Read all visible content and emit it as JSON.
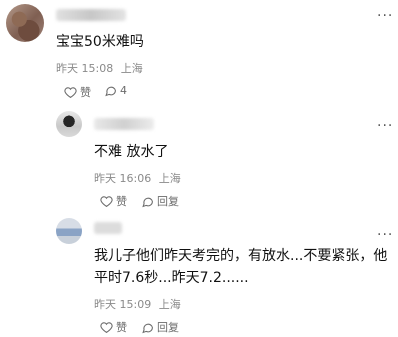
{
  "main_comment": {
    "text": "宝宝50米难吗",
    "time": "昨天 15:08",
    "location": "上海",
    "like_label": "赞",
    "reply_count": "4"
  },
  "replies": [
    {
      "text": "不难 放水了",
      "time": "昨天 16:06",
      "location": "上海",
      "like_label": "赞",
      "reply_label": "回复"
    },
    {
      "text_line1": "我儿子他们昨天考完的，有放水...不要紧张，他",
      "text_line2": "平时7.6秒...昨天7.2......",
      "time": "昨天 15:09",
      "location": "上海",
      "like_label": "赞",
      "reply_label": "回复"
    }
  ],
  "more_icon_text": "···"
}
